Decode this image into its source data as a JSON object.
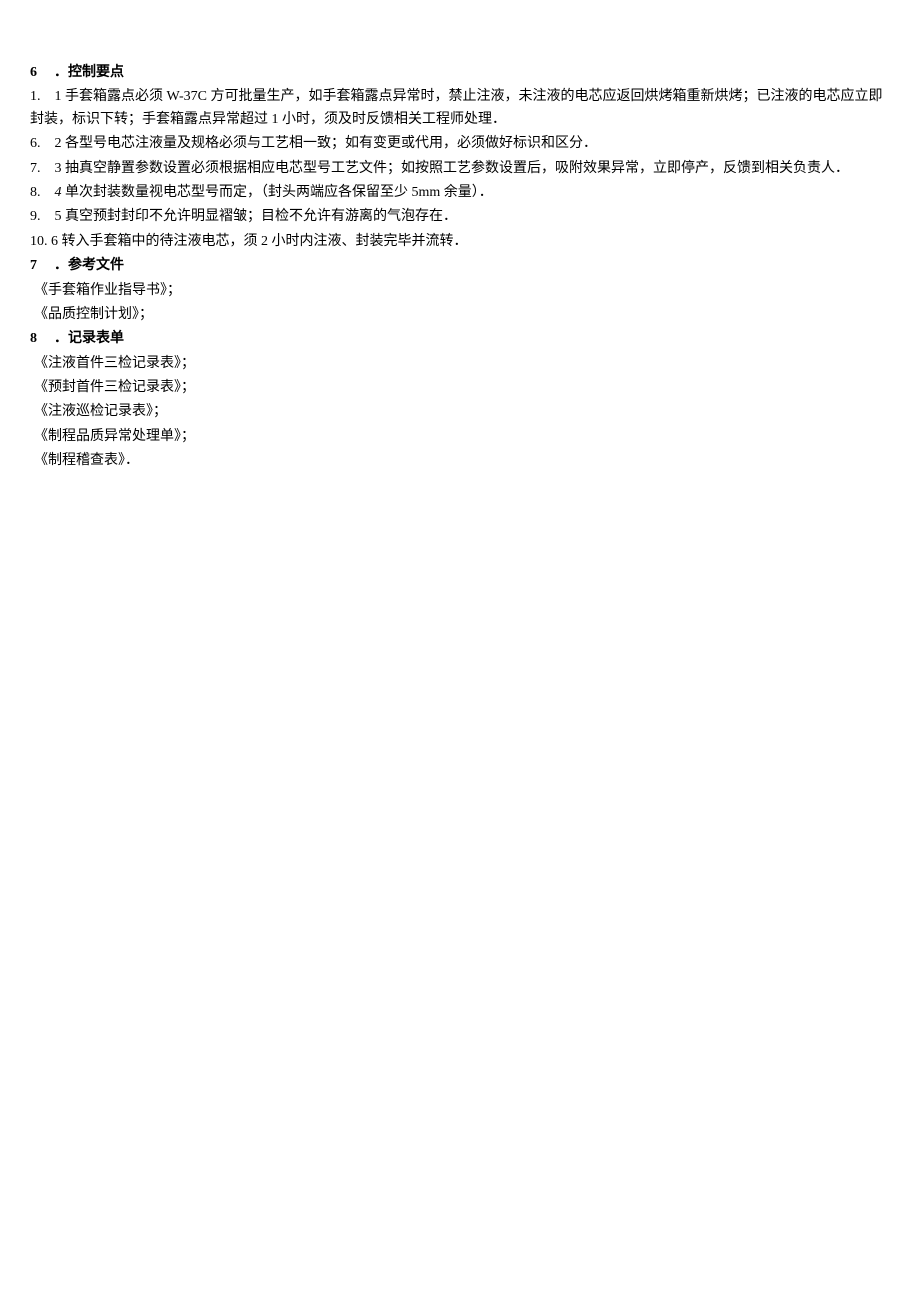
{
  "section6": {
    "num": "6",
    "title": "．控制要点",
    "items": [
      "1.　1 手套箱露点必须 W-37C 方可批量生产，如手套箱露点异常时，禁止注液，未注液的电芯应返回烘烤箱重新烘烤；已注液的电芯应立即封装，标识下转；手套箱露点异常超过 1 小时，须及时反馈相关工程师处理．",
      "6.　2 各型号电芯注液量及规格必须与工艺相一致；如有变更或代用，必须做好标识和区分．",
      "7.　3 抽真空静置参数设置必须根据相应电芯型号工艺文件；如按照工艺参数设置后，吸附效果异常，立即停产，反馈到相关负责人．",
      "8.　4 单次封装数量视电芯型号而定，（封头两端应各保留至少 5mm 余量）．",
      "9.　5 真空预封封印不允许明显褶皱；目检不允许有游离的气泡存在．",
      "10. 6 转入手套箱中的待注液电芯，须 2 小时内注液、封装完毕并流转．"
    ]
  },
  "section7": {
    "num": "7",
    "title": "．参考文件",
    "items": [
      "《手套箱作业指导书》；",
      "《品质控制计划》；"
    ]
  },
  "section8": {
    "num": "8",
    "title": "．记录表单",
    "items": [
      "《注液首件三检记录表》；",
      "《预封首件三检记录表》；",
      "《注液巡检记录表》；",
      "《制程品质异常处理单》；",
      "《制程稽查表》．"
    ]
  }
}
